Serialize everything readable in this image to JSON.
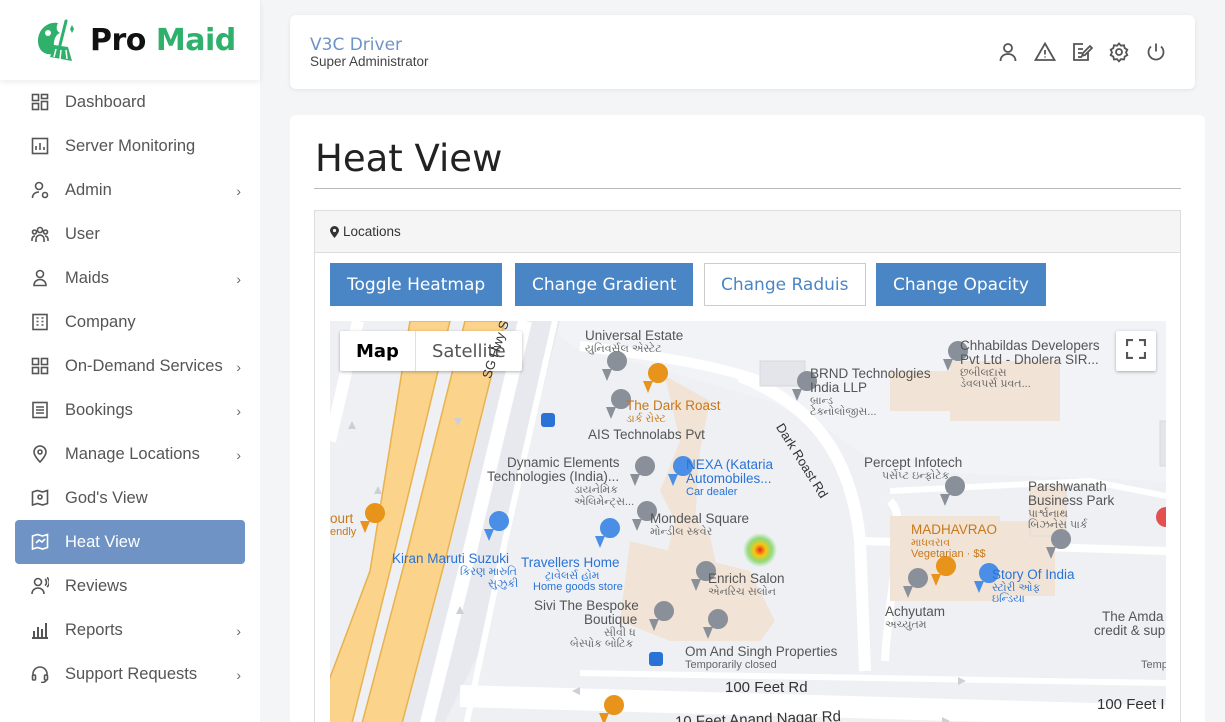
{
  "brand": {
    "name_part1": "Pro",
    "name_part2": "Maid",
    "accent": "#2fb06b"
  },
  "sidebar": {
    "items": [
      {
        "label": "Dashboard",
        "icon": "dashboard-grid-icon",
        "has_children": false
      },
      {
        "label": "Server Monitoring",
        "icon": "chart-icon",
        "has_children": false
      },
      {
        "label": "Admin",
        "icon": "user-gear-icon",
        "has_children": true
      },
      {
        "label": "User",
        "icon": "users-icon",
        "has_children": false
      },
      {
        "label": "Maids",
        "icon": "person-icon",
        "has_children": true
      },
      {
        "label": "Company",
        "icon": "building-icon",
        "has_children": false
      },
      {
        "label": "On-Demand Services",
        "icon": "grid-icon",
        "has_children": true
      },
      {
        "label": "Bookings",
        "icon": "list-icon",
        "has_children": true
      },
      {
        "label": "Manage Locations",
        "icon": "location-pin-icon",
        "has_children": true
      },
      {
        "label": "God's View",
        "icon": "map-user-icon",
        "has_children": false
      },
      {
        "label": "Heat View",
        "icon": "heat-map-icon",
        "has_children": false,
        "active": true
      },
      {
        "label": "Reviews",
        "icon": "review-icon",
        "has_children": false
      },
      {
        "label": "Reports",
        "icon": "bar-chart-icon",
        "has_children": true
      },
      {
        "label": "Support Requests",
        "icon": "headset-icon",
        "has_children": true
      }
    ],
    "chevron": "›"
  },
  "header": {
    "user_name": "V3C Driver",
    "user_role": "Super Administrator",
    "icons": [
      "profile-icon",
      "alert-icon",
      "edit-icon",
      "settings-icon",
      "power-icon"
    ]
  },
  "main": {
    "title": "Heat View",
    "panel_title": "Locations",
    "buttons": {
      "toggle": "Toggle Heatmap",
      "gradient": "Change Gradient",
      "radius": "Change Raduis",
      "opacity": "Change Opacity"
    }
  },
  "map": {
    "type_map": "Map",
    "type_satellite": "Satellite",
    "labels": {
      "universal": "Universal Estate",
      "universal_gu": "યુનિવર્સલ એસ્ટેટ",
      "dark_roast": "The Dark Roast",
      "dark_roast_gu": "ડાર્ક રોસ્ટ",
      "ais": "AIS Technolabs Pvt",
      "dynamic": "Dynamic Elements",
      "dynamic2": "Technologies (India)...",
      "dynamic_gu1": "ડાયનેમિક",
      "dynamic_gu2": "એલિમેન્ટ્સ...",
      "nexa": "NEXA (Kataria",
      "nexa2": "Automobiles...",
      "nexa_sub": "Car dealer",
      "mondeal": "Mondeal Square",
      "mondeal_gu": "મોન્ડીલ સ્કવેર",
      "kiran": "Kiran Maruti Suzuki",
      "kiran_gu1": "કિરણ મારુતિ",
      "kiran_gu2": "સુઝુકી",
      "travellers": "Travellers Home",
      "travellers_gu": "ટ્રાવેલર્સ હોમ",
      "travellers_sub": "Home goods store",
      "enrich": "Enrich Salon",
      "enrich_gu": "એનરિચ સલોન",
      "sivi": "Sivi The Bespoke",
      "sivi2": "Boutique",
      "sivi_gu1": "સીવી ધ",
      "sivi_gu2": "બેસ્પોક બોટિક",
      "omand": "Om And Singh Properties",
      "omand_sub": "Temporarily closed",
      "road_100ft": "100 Feet Rd",
      "road_100ft_b": "100 Feet I",
      "road_anand": "10 Feet Anand Nagar Rd",
      "sg_hwy": "SG Hwy Service",
      "dark_roast_rd": "Dark Roast Rd",
      "brnd": "BRND Technologies",
      "brnd2": "India LLP",
      "brnd_gu1": "બ્રાન્ડ",
      "brnd_gu2": "ટેક્નોલોજીસ...",
      "chhab": "Chhabildas Developers",
      "chhab2": "Pvt Ltd - Dholera SIR...",
      "chhab_gu1": "છબીલદાસ",
      "chhab_gu2": "ડેવલપર્સ પ્રવત...",
      "percept": "Percept Infotech",
      "percept_gu": "પર્સેપ્ટ ઇન્ફોટેક",
      "parsh": "Parshwanath",
      "parsh2": "Business Park",
      "parsh_gu1": "પાર્શ્વનાથ",
      "parsh_gu2": "બિઝનેસ પાર્ક",
      "madhav": "MADHAVRAO",
      "madhav_gu": "માધવરાવ",
      "madhav_sub": "Vegetarian · $$",
      "story": "Story Of India",
      "story_gu1": "સ્ટોરી ઓફ",
      "story_gu2": "ઇન્ડિયા",
      "achyutam": "Achyutam",
      "achyutam_gu": "અચ્યુતમ",
      "amda": "The Amda",
      "amda2": "credit & sup",
      "court": "ourt",
      "court2": "endly",
      "temp": "Temp"
    }
  }
}
